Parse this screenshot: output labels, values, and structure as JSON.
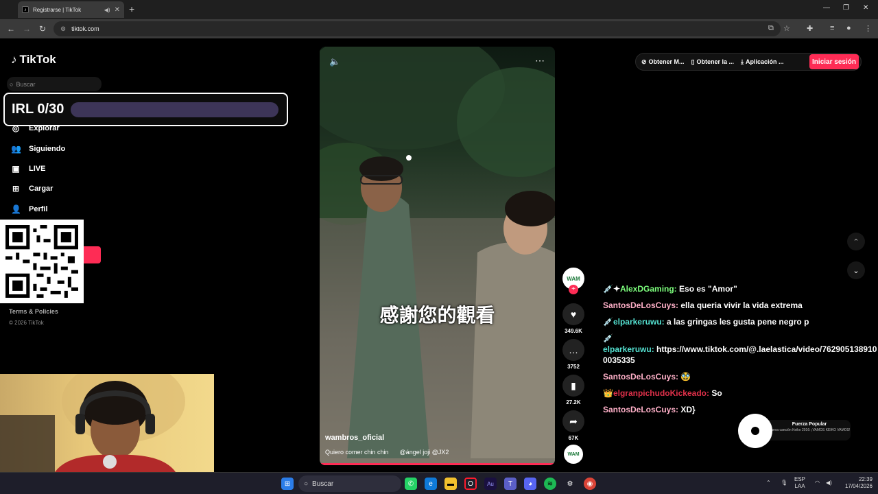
{
  "browser": {
    "tab_title": "Registrarse | TikTok",
    "url": "tiktok.com"
  },
  "sidebar": {
    "logo": "TikTok",
    "search_placeholder": "Buscar",
    "nav": [
      {
        "label": "Explorar",
        "icon": "compass-icon"
      },
      {
        "label": "Siguiendo",
        "icon": "following-icon"
      },
      {
        "label": "LIVE",
        "icon": "live-icon"
      },
      {
        "label": "Cargar",
        "icon": "upload-icon"
      },
      {
        "label": "Perfil",
        "icon": "profile-icon"
      }
    ],
    "footer_links": "Terms & Policies",
    "copyright": "© 2026 TikTok"
  },
  "overlay": {
    "irl_counter": "IRL 0/30",
    "irl_progress": 0
  },
  "video": {
    "subtitle": "感謝您的觀看",
    "username": "wambros_oficial",
    "description": "Quiero comer chin chin",
    "mention": "@ángel joji @JX2"
  },
  "actions": {
    "avatar_text": "WAM",
    "likes": "349.6K",
    "comments": "3752",
    "saves": "27.2K",
    "shares": "67K"
  },
  "topbar": {
    "item1": "Obtener M...",
    "item2": "Obtener la ...",
    "item3": "Aplicación ...",
    "login": "Iniciar sesión"
  },
  "chat": [
    {
      "prefix": "💉✦",
      "user": "AlexDGaming:",
      "color": "#7dff7d",
      "msg": "Eso es \"Amor\""
    },
    {
      "prefix": "",
      "user": "SantosDeLosCuys:",
      "color": "#ffb0c8",
      "msg": "ella queria vivir la vida extrema"
    },
    {
      "prefix": "💉",
      "user": "elparkeruwu:",
      "color": "#54e0d0",
      "msg": "a las gringas les gusta pene negro p"
    },
    {
      "prefix": "💉",
      "user": "elparkeruwu:",
      "color": "#54e0d0",
      "msg": "https://www.tiktok.com/@.laelastica/video/7629051389100035335",
      "block": true
    },
    {
      "prefix": "",
      "user": "SantosDeLosCuys:",
      "color": "#ffb0c8",
      "msg": "🥸"
    },
    {
      "prefix": "👑",
      "user": "elgranpichudoKickeado:",
      "color": "#e0304a",
      "msg": "So"
    },
    {
      "prefix": "",
      "user": "SantosDeLosCuys:",
      "color": "#ffb0c8",
      "msg": "XD}"
    }
  ],
  "now_playing": {
    "title": "Fuerza Popular",
    "artist": "Nueva canción Keiko 2016: ¡VAMOS KEIKO VAMOS!"
  },
  "taskbar": {
    "search": "Buscar",
    "lang_top": "ESP",
    "lang_bottom": "LAA",
    "time": "22:39",
    "date": "17/04/2026"
  }
}
